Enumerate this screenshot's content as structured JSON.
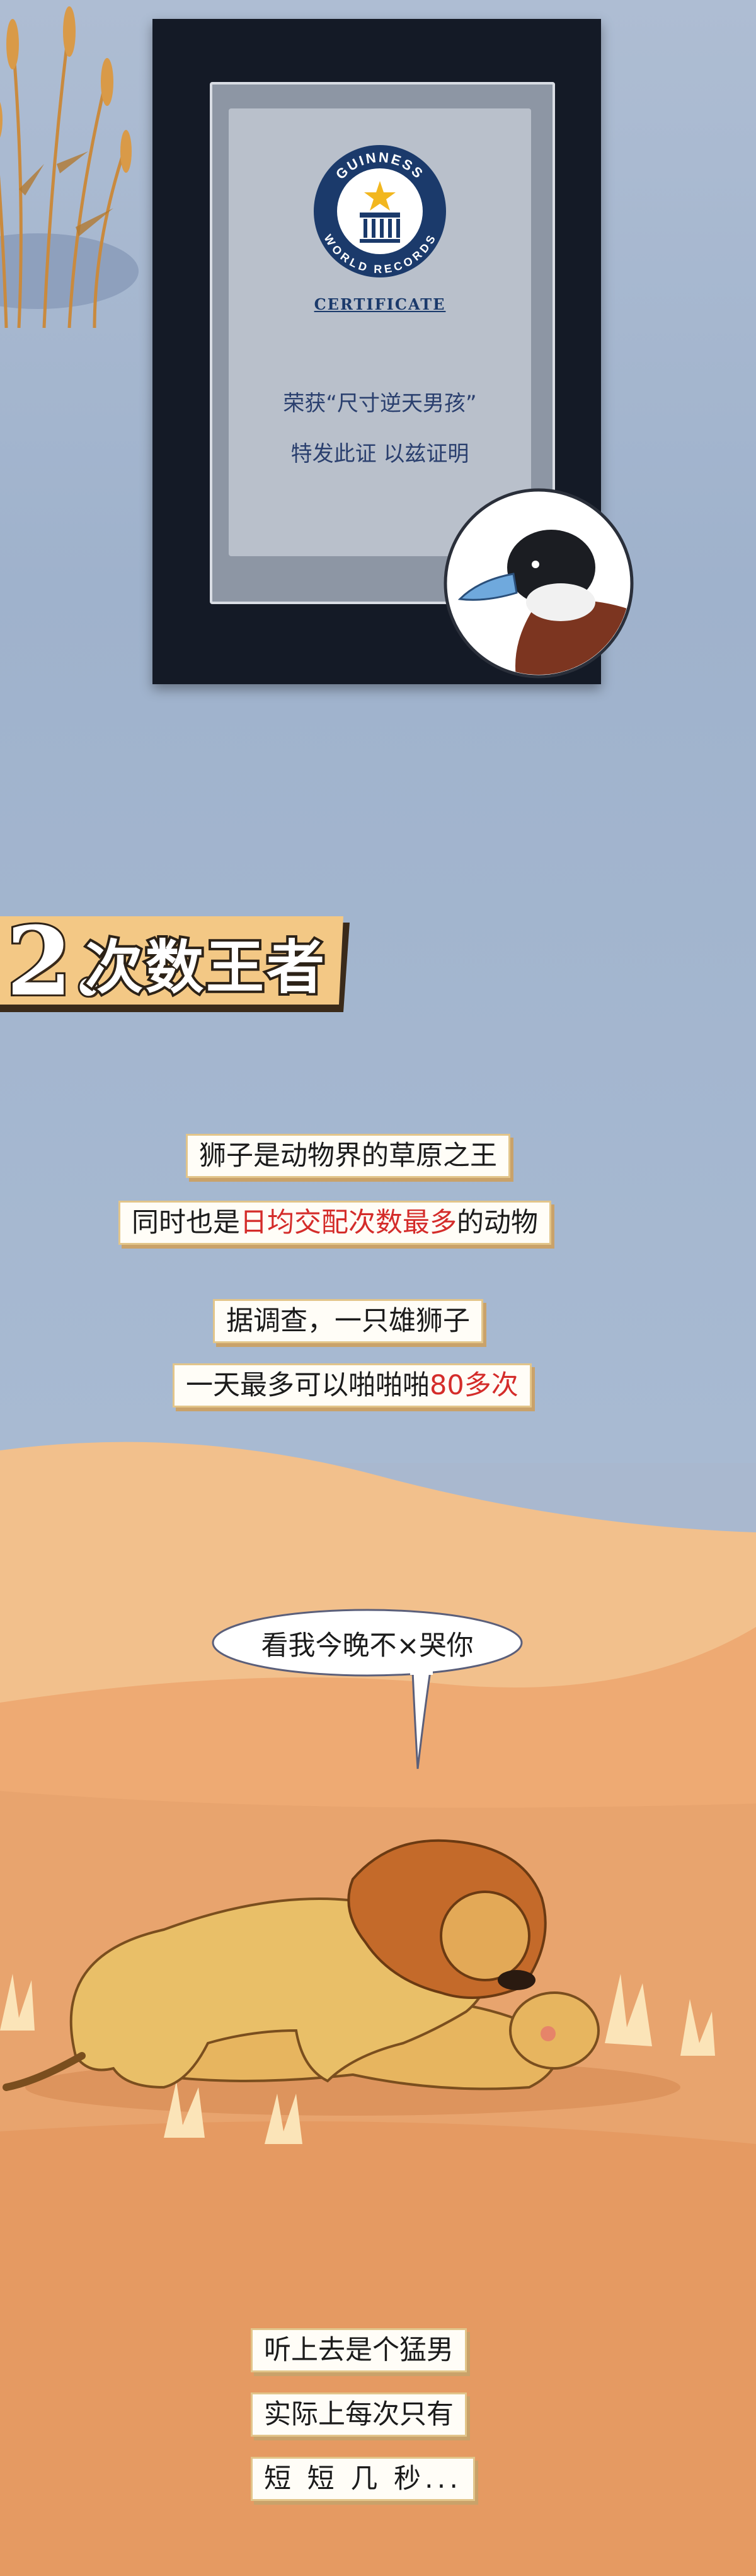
{
  "certificate": {
    "logo_top": "GUINNESS",
    "logo_bottom": "WORLD RECORDS",
    "certificate_word": "CERTIFICATE",
    "line1": "荣获“尺寸逆天男孩”",
    "line2": "特发此证  以兹证明"
  },
  "section2": {
    "number": "2.",
    "title": "次数王者"
  },
  "captions": {
    "c1": "狮子是动物界的草原之王",
    "c2_pre": "同时也是",
    "c2_red": "日均交配次数最多",
    "c2_post": "的动物",
    "c3": "据调查，一只雄狮子",
    "c4_pre": "一天最多可以啪啪啪",
    "c4_red": "80多次",
    "c5": "听上去是个猛男",
    "c6": "实际上每次只有",
    "c7": "短 短 几 秒..."
  },
  "bubble": {
    "text": "看我今晚不×哭你"
  },
  "icons": {
    "duck": "duck-illustration",
    "lions": "lions-illustration",
    "reeds": "reeds-illustration"
  },
  "colors": {
    "sky": "#a9b8cf",
    "desert": "#e8a46e",
    "highlight_red": "#d42c2a",
    "cert_frame": "#141a26"
  }
}
